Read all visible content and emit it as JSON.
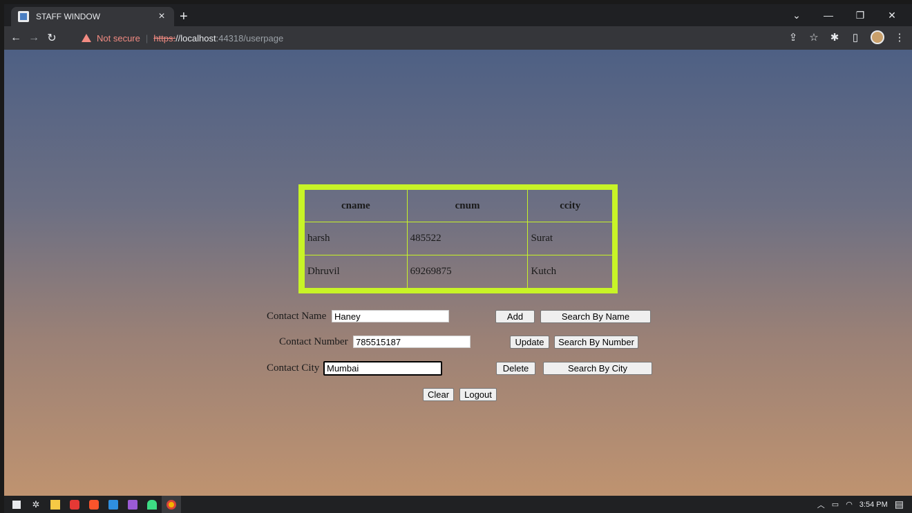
{
  "browser": {
    "tab_title": "STAFF WINDOW",
    "tab_close": "×",
    "new_tab": "+",
    "not_secure": "Not secure",
    "url_scheme": "https:",
    "url_host": "//localhost",
    "url_path": ":44318/userpage",
    "window_controls": [
      "⌄",
      "—",
      "❐",
      "✕"
    ]
  },
  "table": {
    "headers": [
      "cname",
      "cnum",
      "ccity"
    ],
    "rows": [
      [
        "harsh",
        "485522",
        "Surat"
      ],
      [
        "Dhruvil",
        "69269875",
        "Kutch"
      ]
    ]
  },
  "form": {
    "name_label": "Contact Name",
    "name_value": "Haney",
    "number_label": "Contact Number",
    "number_value": "785515187",
    "city_label": "Contact City",
    "city_value": "Mumbai",
    "add": "Add",
    "update": "Update",
    "delete": "Delete",
    "search_name": "Search By Name",
    "search_number": "Search By Number",
    "search_city": "Search By City",
    "clear": "Clear",
    "logout": "Logout"
  },
  "taskbar": {
    "time": "3:54 PM"
  },
  "colors": {
    "grid_border": "#c8f427",
    "gradient_top": "#4e6084",
    "gradient_bottom": "#bf9370"
  }
}
